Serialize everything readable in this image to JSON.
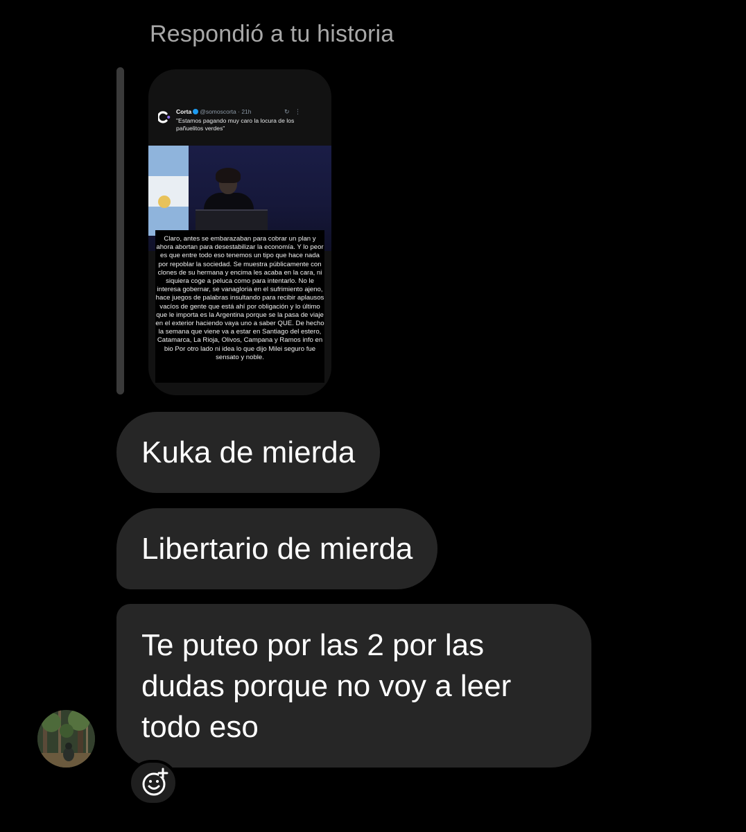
{
  "reply_header": "Respondió a tu historia",
  "story": {
    "tweet": {
      "account_name": "Corta",
      "handle_time": "@somoscorta · 21h",
      "text": "\"Estamos pagando muy caro la locura de los pañuelitos verdes\""
    },
    "caption": "Claro, antes se embarazaban para cobrar un plan y ahora abortan para desestabilizar la economía. Y lo peor es que entre todo eso tenemos un tipo que hace nada por repoblar la sociedad. Se muestra públicamente con clones de su hermana y encima les acaba en la cara, ni siquiera coge a peluca como para intentarlo. No le interesa gobernar, se vanagloria en el sufrimiento ajeno, hace juegos de palabras insultando para recibir aplausos vacíos de gente que está ahí por obligación y lo último que le importa es la Argentina porque se la pasa de viaje en el exterior haciendo vaya uno a saber QUE. De hecho la semana que viene va a estar en Santiago del estero, Catamarca, La Rioja, Olivos, Campana y Ramos info en bio Por otro lado ni idea lo que dijo Milei seguro fue sensato y noble."
  },
  "messages": [
    {
      "text": "Kuka de mierda"
    },
    {
      "text": "Libertario de mierda"
    },
    {
      "text": "Te puteo por las 2 por las dudas porque no voy a leer todo eso"
    }
  ],
  "icons": {
    "avatar": "avatar-photo",
    "reaction": "add-reaction-smiley-icon"
  },
  "colors": {
    "background": "#000000",
    "bubble": "#262626",
    "header_text": "#a8a8a8"
  }
}
